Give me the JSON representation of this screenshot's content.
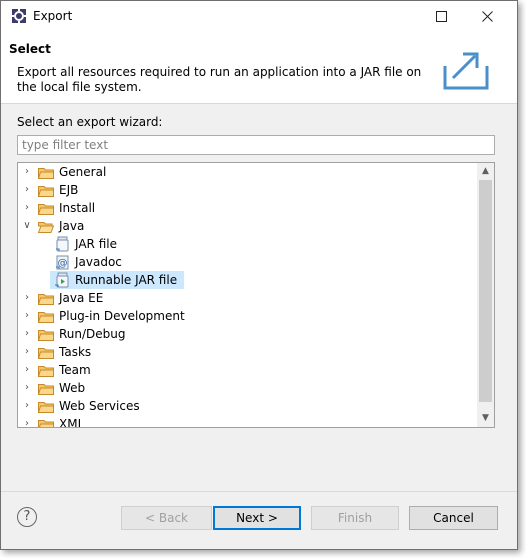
{
  "window": {
    "title": "Export",
    "app_icon": "eclipse-gear-icon"
  },
  "header": {
    "title": "Select",
    "description": "Export all resources required to run an application into a JAR file on the local file system.",
    "banner_icon": "export-arrow-icon"
  },
  "wizard": {
    "label": "Select an export wizard:",
    "filter_placeholder": "type filter text",
    "filter_value": ""
  },
  "tree": {
    "items": [
      {
        "label": "General",
        "type": "folder",
        "expanded": false,
        "level": 0
      },
      {
        "label": "EJB",
        "type": "folder",
        "expanded": false,
        "level": 0
      },
      {
        "label": "Install",
        "type": "folder",
        "expanded": false,
        "level": 0
      },
      {
        "label": "Java",
        "type": "folder",
        "expanded": true,
        "level": 0
      },
      {
        "label": "JAR file",
        "type": "jar-icon",
        "level": 1
      },
      {
        "label": "Javadoc",
        "type": "javadoc-icon",
        "level": 1
      },
      {
        "label": "Runnable JAR file",
        "type": "runnable-jar-icon",
        "level": 1,
        "selected": true
      },
      {
        "label": "Java EE",
        "type": "folder",
        "expanded": false,
        "level": 0
      },
      {
        "label": "Plug-in Development",
        "type": "folder",
        "expanded": false,
        "level": 0
      },
      {
        "label": "Run/Debug",
        "type": "folder",
        "expanded": false,
        "level": 0
      },
      {
        "label": "Tasks",
        "type": "folder",
        "expanded": false,
        "level": 0
      },
      {
        "label": "Team",
        "type": "folder",
        "expanded": false,
        "level": 0
      },
      {
        "label": "Web",
        "type": "folder",
        "expanded": false,
        "level": 0
      },
      {
        "label": "Web Services",
        "type": "folder",
        "expanded": false,
        "level": 0
      },
      {
        "label": "XML",
        "type": "folder",
        "expanded": false,
        "level": 0
      }
    ]
  },
  "buttons": {
    "back": "< Back",
    "next": "Next >",
    "finish": "Finish",
    "cancel": "Cancel"
  },
  "colors": {
    "selection": "#cce8ff",
    "accent": "#0078d7",
    "folder": "#e8a33d"
  }
}
